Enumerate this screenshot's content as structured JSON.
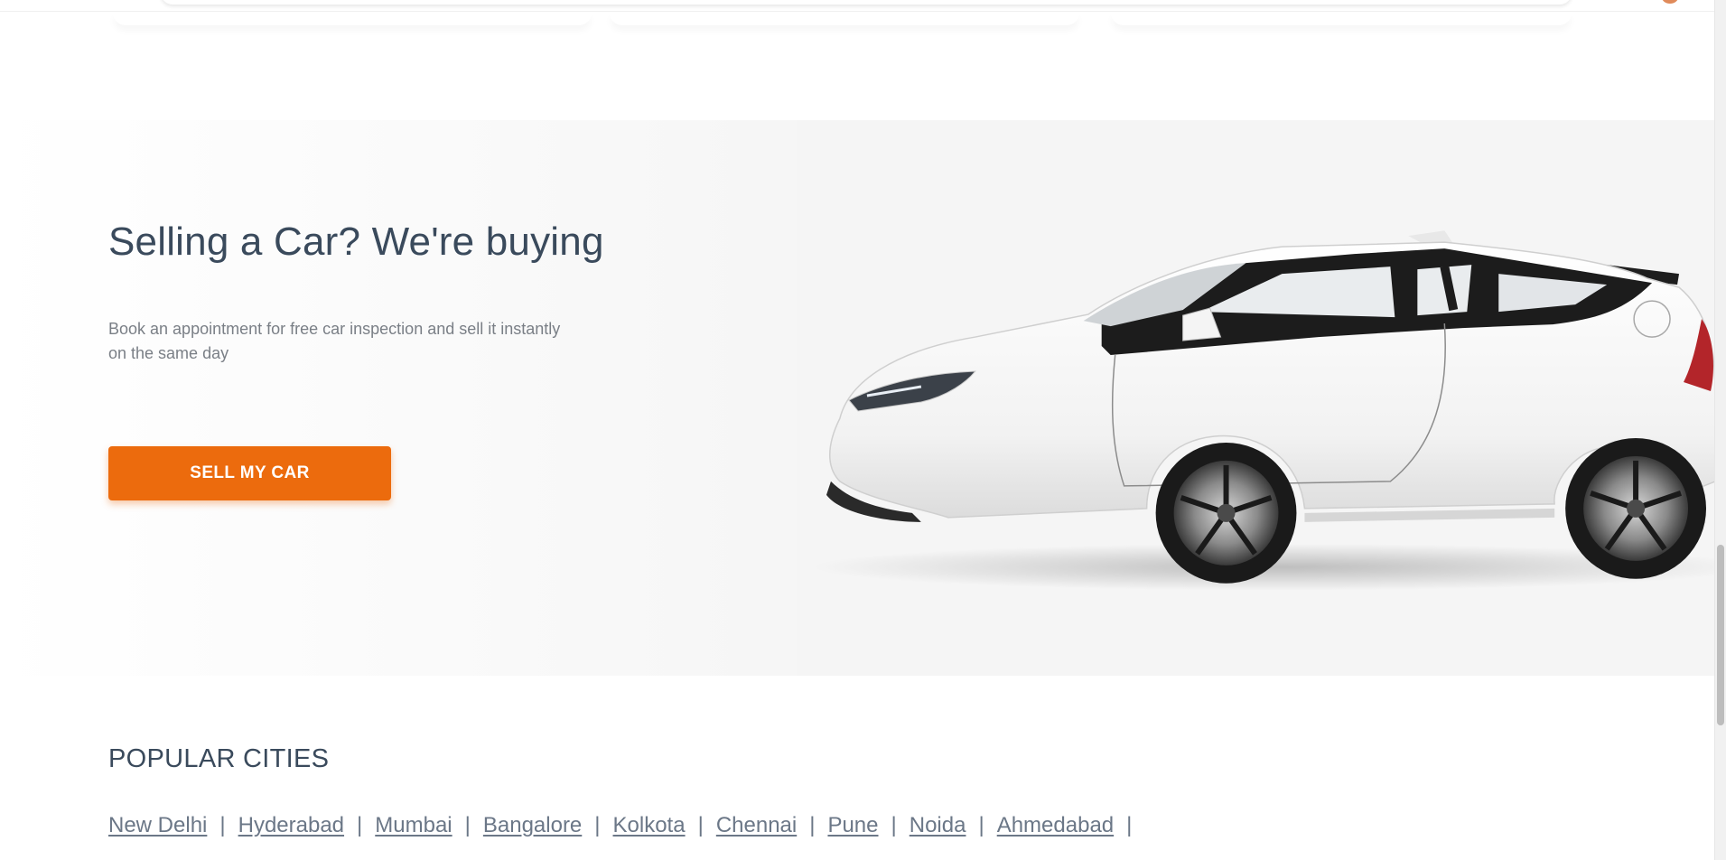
{
  "hero": {
    "title": "Selling a Car? We're buying",
    "description": "Book an appointment for free car inspection and sell it instantly on the same day",
    "button_label": "SELL MY CAR",
    "accent_color": "#ec6b0d",
    "image_icon": "white-hatchback-car"
  },
  "popular_cities": {
    "heading": "POPULAR CITIES",
    "cities": [
      "New Delhi",
      "Hyderabad",
      "Mumbai",
      "Bangalore",
      "Kolkota",
      "Chennai",
      "Pune",
      "Noida",
      "Ahmedabad"
    ],
    "separator": "|"
  }
}
